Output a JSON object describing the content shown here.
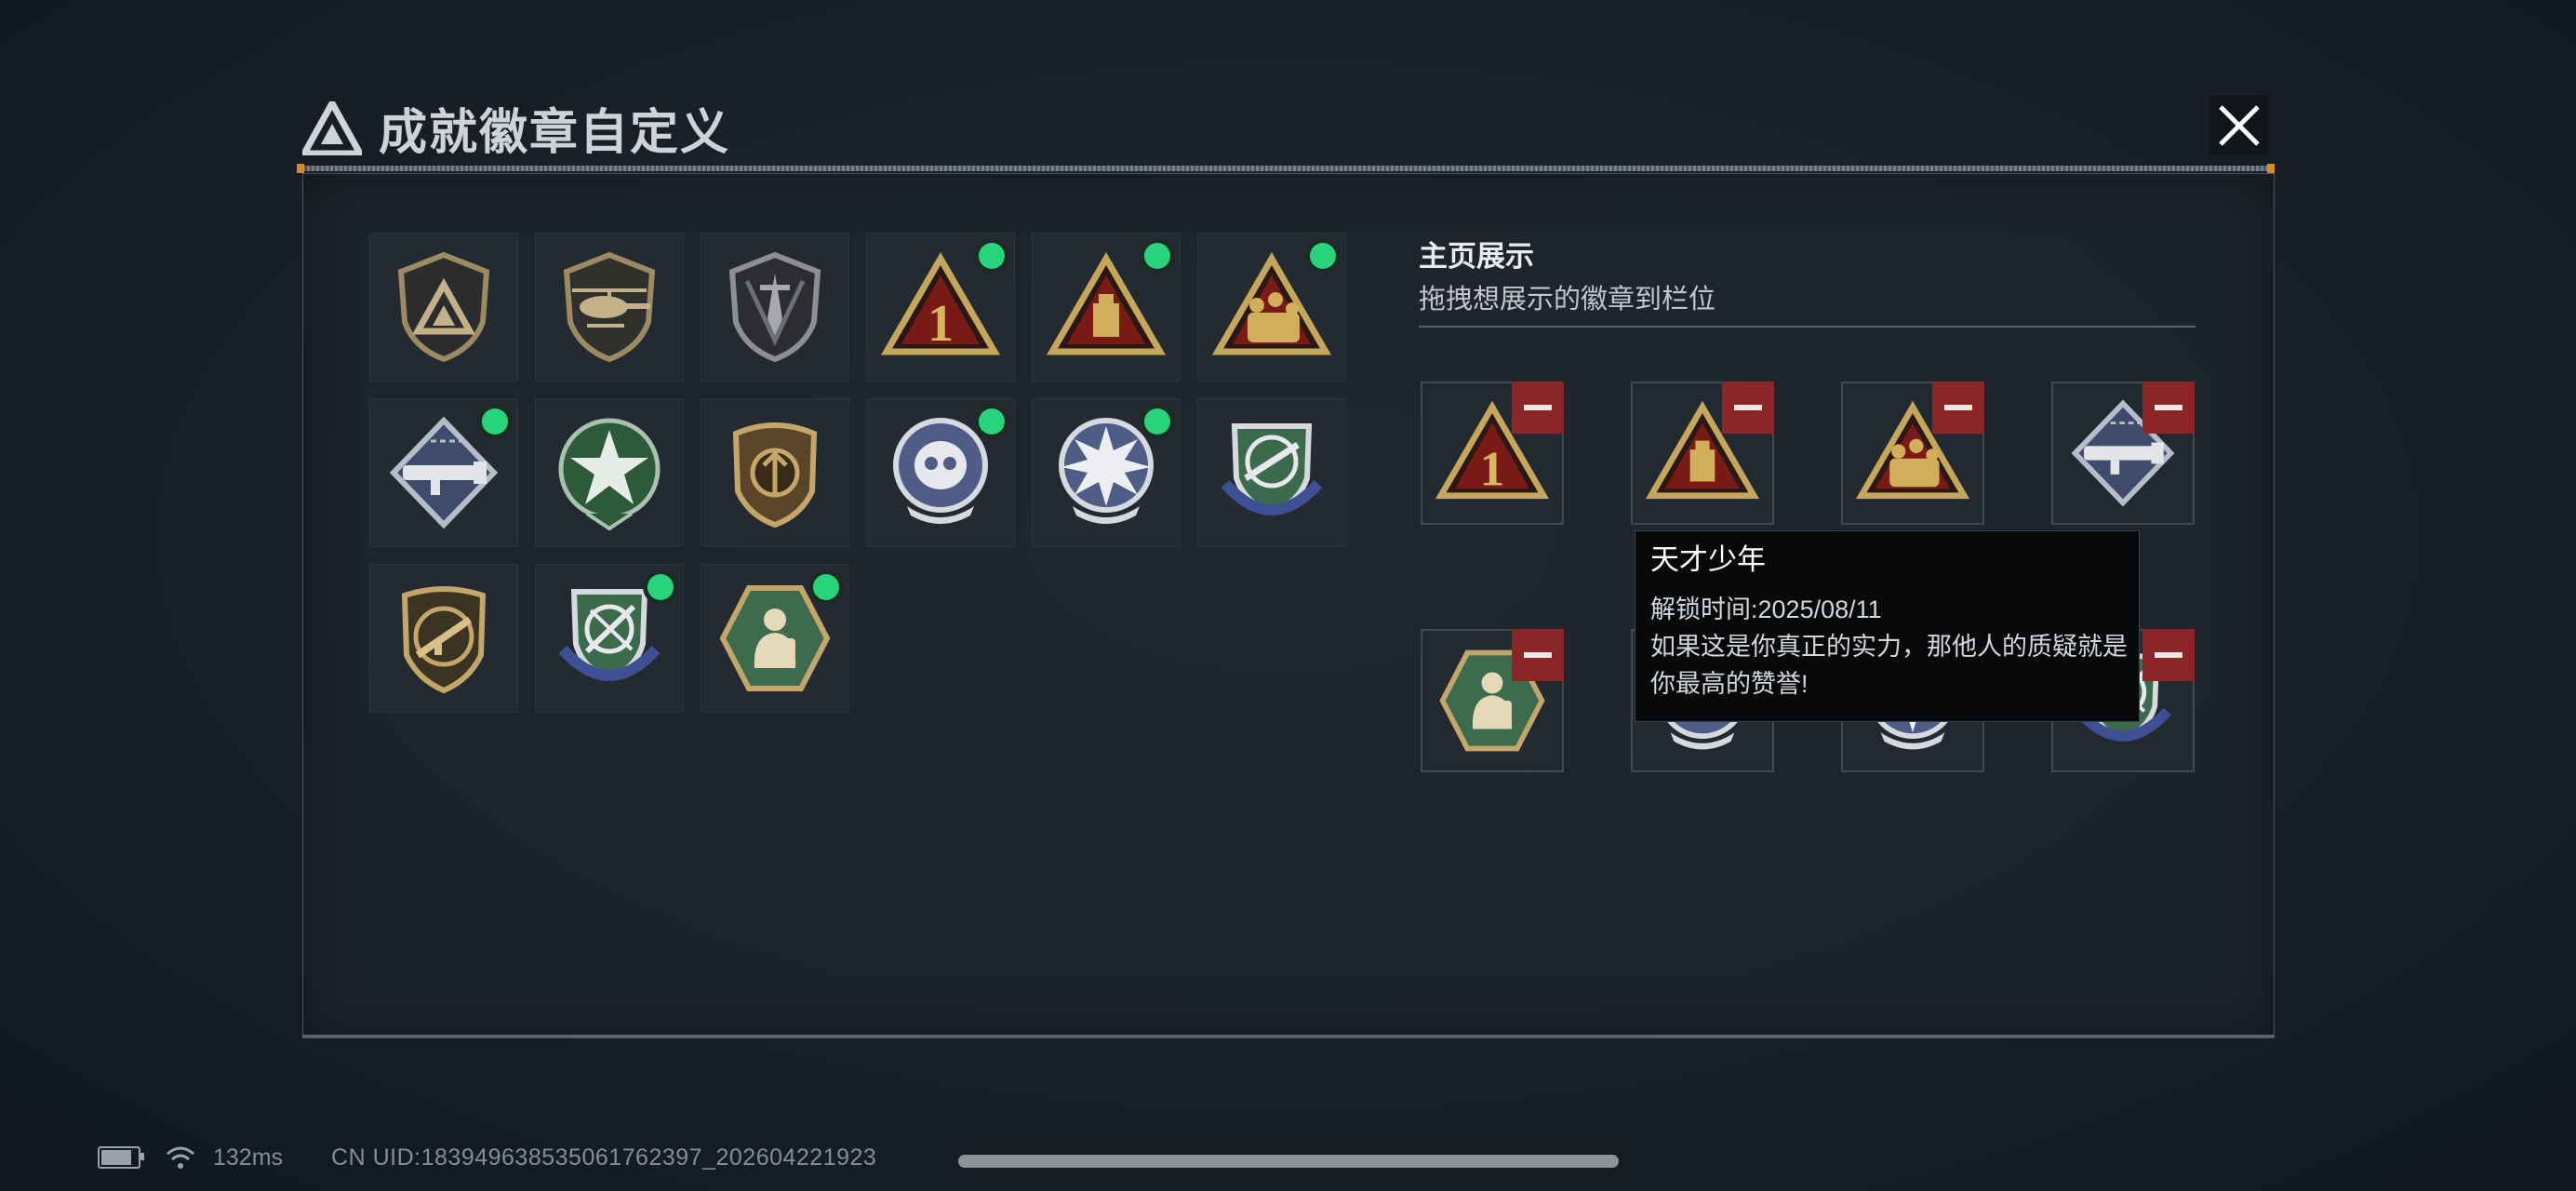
{
  "window": {
    "title": "成就徽章自定义"
  },
  "collection": {
    "badges": [
      {
        "icon": "shield-delta-badge-icon",
        "new": false
      },
      {
        "icon": "helicopter-badge-icon",
        "new": false
      },
      {
        "icon": "dagger-badge-icon",
        "new": false
      },
      {
        "icon": "number-one-triangle-badge-icon",
        "new": true
      },
      {
        "icon": "chip-triangle-badge-icon",
        "new": true
      },
      {
        "icon": "squad-triangle-badge-icon",
        "new": true
      },
      {
        "icon": "launcher-diamond-badge-icon",
        "new": true
      },
      {
        "icon": "green-star-badge-icon",
        "new": false
      },
      {
        "icon": "bronze-crest-badge-icon",
        "new": false
      },
      {
        "icon": "skull-blue-badge-icon",
        "new": true
      },
      {
        "icon": "blast-blue-badge-icon",
        "new": true
      },
      {
        "icon": "rifle-blue-shield-badge-icon",
        "new": false
      },
      {
        "icon": "smg-crosshair-badge-icon",
        "new": false
      },
      {
        "icon": "knife-blue-shield-badge-icon",
        "new": true
      },
      {
        "icon": "soldier-hexagon-badge-icon",
        "new": true
      }
    ]
  },
  "showcase": {
    "title": "主页展示",
    "subtitle": "拖拽想展示的徽章到栏位",
    "slots": [
      {
        "icon": "number-one-triangle-badge-icon"
      },
      {
        "icon": "chip-triangle-badge-icon"
      },
      {
        "icon": "squad-triangle-badge-icon"
      },
      {
        "icon": "launcher-diamond-badge-icon"
      },
      {
        "icon": "soldier-hexagon-badge-icon"
      },
      {
        "icon": "skull-blue-badge-icon"
      },
      {
        "icon": "blast-blue-badge-icon"
      },
      {
        "icon": "knife-blue-shield-badge-icon"
      }
    ]
  },
  "tooltip": {
    "name": "天才少年",
    "unlock_label": "解锁时间:",
    "unlock_date": "2025/08/11",
    "description": "如果这是你真正的实力，那他人的质疑就是你最高的赞誉!"
  },
  "footer": {
    "battery_level": 0.85,
    "latency": "132ms",
    "uid": "CN UID:18394963853506176239­7_202604221923"
  },
  "colors": {
    "new_dot": "#27d47b",
    "remove": "#8c2626",
    "panel": "#1e242c"
  }
}
